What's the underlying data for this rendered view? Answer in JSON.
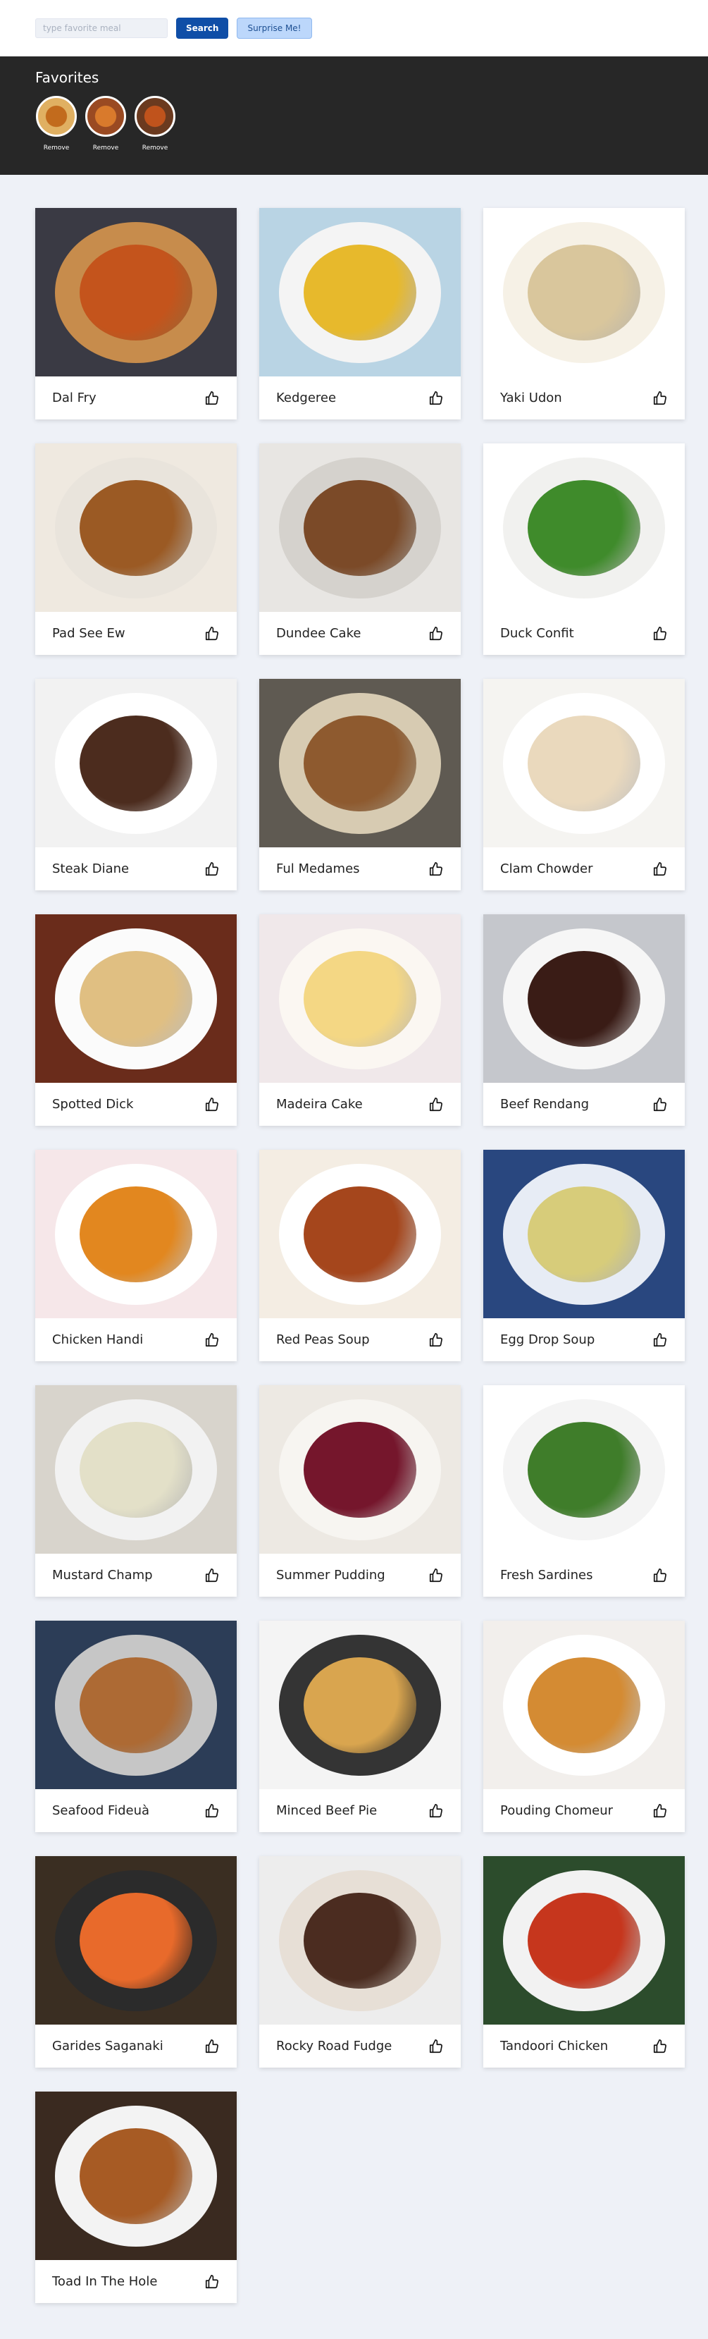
{
  "search": {
    "placeholder": "type favorite meal",
    "value": ""
  },
  "buttons": {
    "search_label": "Search",
    "surprise_label": "Surprise Me!"
  },
  "favorites": {
    "title": "Favorites",
    "items": [
      {
        "remove_label": "Remove",
        "bg": "#e0b062",
        "food": "#c26b1d"
      },
      {
        "remove_label": "Remove",
        "bg": "#9a4a22",
        "food": "#d97a2c"
      },
      {
        "remove_label": "Remove",
        "bg": "#6b3a1f",
        "food": "#c0531c"
      }
    ]
  },
  "meals": [
    {
      "name": "Dal Fry",
      "bg": "#3a3a44",
      "plate": "#c78c4c",
      "food": "#c4541c"
    },
    {
      "name": "Kedgeree",
      "bg": "#b9d4e4",
      "plate": "#f4f4f4",
      "food": "#e7b92c"
    },
    {
      "name": "Yaki Udon",
      "bg": "#ffffff",
      "plate": "#f6f1e6",
      "food": "#d9c69c"
    },
    {
      "name": "Pad See Ew",
      "bg": "#efe9e0",
      "plate": "#e9e4dc",
      "food": "#9b5a24"
    },
    {
      "name": "Dundee Cake",
      "bg": "#e8e6e3",
      "plate": "#d5d2cd",
      "food": "#7b4a28"
    },
    {
      "name": "Duck Confit",
      "bg": "#ffffff",
      "plate": "#f1f1ef",
      "food": "#3f8b2b"
    },
    {
      "name": "Steak Diane",
      "bg": "#f2f2f2",
      "plate": "#ffffff",
      "food": "#4c2c1e"
    },
    {
      "name": "Ful Medames",
      "bg": "#5f5a52",
      "plate": "#d7cbb2",
      "food": "#8e5a2f"
    },
    {
      "name": "Clam Chowder",
      "bg": "#f5f4f1",
      "plate": "#ffffff",
      "food": "#ead9bd"
    },
    {
      "name": "Spotted Dick",
      "bg": "#6a2c1b",
      "plate": "#fbfbfb",
      "food": "#e0bf82"
    },
    {
      "name": "Madeira Cake",
      "bg": "#f0e8ea",
      "plate": "#fbf7f2",
      "food": "#f4d784"
    },
    {
      "name": "Beef Rendang",
      "bg": "#c5c7cc",
      "plate": "#f6f6f6",
      "food": "#3a1c16"
    },
    {
      "name": "Chicken Handi",
      "bg": "#f6e7e9",
      "plate": "#ffffff",
      "food": "#e2871f"
    },
    {
      "name": "Red Peas Soup",
      "bg": "#f4ede3",
      "plate": "#ffffff",
      "food": "#a5461c"
    },
    {
      "name": "Egg Drop Soup",
      "bg": "#29477f",
      "plate": "#e7ecf5",
      "food": "#d7cc7a"
    },
    {
      "name": "Mustard Champ",
      "bg": "#d8d4cc",
      "plate": "#f2f2f2",
      "food": "#e3e0c8"
    },
    {
      "name": "Summer Pudding",
      "bg": "#ede9e3",
      "plate": "#f7f5f1",
      "food": "#75162c"
    },
    {
      "name": "Fresh Sardines",
      "bg": "#ffffff",
      "plate": "#f4f4f4",
      "food": "#3f7d2a"
    },
    {
      "name": "Seafood Fideuà",
      "bg": "#2c3d57",
      "plate": "#c6c6c6",
      "food": "#ad6a34"
    },
    {
      "name": "Minced Beef Pie",
      "bg": "#f4f4f4",
      "plate": "#343434",
      "food": "#d9a54f"
    },
    {
      "name": "Pouding Chomeur",
      "bg": "#f2efec",
      "plate": "#ffffff",
      "food": "#d48b33"
    },
    {
      "name": "Garides Saganaki",
      "bg": "#3a2e22",
      "plate": "#2b2b2b",
      "food": "#e86a2b"
    },
    {
      "name": "Rocky Road Fudge",
      "bg": "#ededed",
      "plate": "#e7dfd6",
      "food": "#4b2c20"
    },
    {
      "name": "Tandoori Chicken",
      "bg": "#2c4c2c",
      "plate": "#f2f2f2",
      "food": "#c6361d"
    },
    {
      "name": "Toad In The Hole",
      "bg": "#3a2a20",
      "plate": "#f3f3f3",
      "food": "#a75b24"
    }
  ]
}
